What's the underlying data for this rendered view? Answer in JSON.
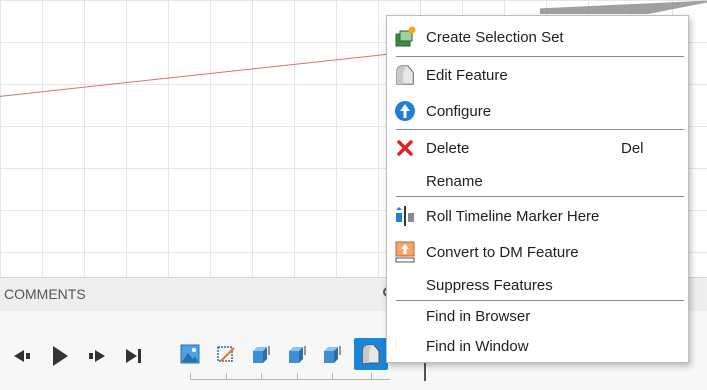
{
  "comments": {
    "label": "COMMENTS"
  },
  "context_menu": {
    "items": [
      {
        "label": "Create Selection Set",
        "icon": "selection-set-icon"
      },
      {
        "label": "Edit Feature",
        "icon": "edit-feature-icon"
      },
      {
        "label": "Configure",
        "icon": "configure-icon"
      },
      {
        "label": "Delete",
        "icon": "delete-icon",
        "shortcut": "Del"
      },
      {
        "label": "Rename",
        "icon": ""
      },
      {
        "label": "Roll Timeline Marker Here",
        "icon": "roll-timeline-marker-icon"
      },
      {
        "label": "Convert to DM Feature",
        "icon": "convert-dm-feature-icon"
      },
      {
        "label": "Suppress Features",
        "icon": ""
      },
      {
        "label": "Find in Browser",
        "icon": ""
      },
      {
        "label": "Find in Window",
        "icon": ""
      }
    ]
  },
  "timeline": {
    "controls": [
      "skip-back-icon",
      "play-icon",
      "step-forward-icon",
      "skip-forward-icon"
    ],
    "items": [
      "sketch-image-icon",
      "sketch-icon",
      "extrude-icon",
      "extrude-icon",
      "extrude-icon",
      "fillet-icon"
    ],
    "active_index": 5
  },
  "colors": {
    "accent": "#1a86d6",
    "delete": "#e02424",
    "viewport_axis": "#e07070"
  }
}
